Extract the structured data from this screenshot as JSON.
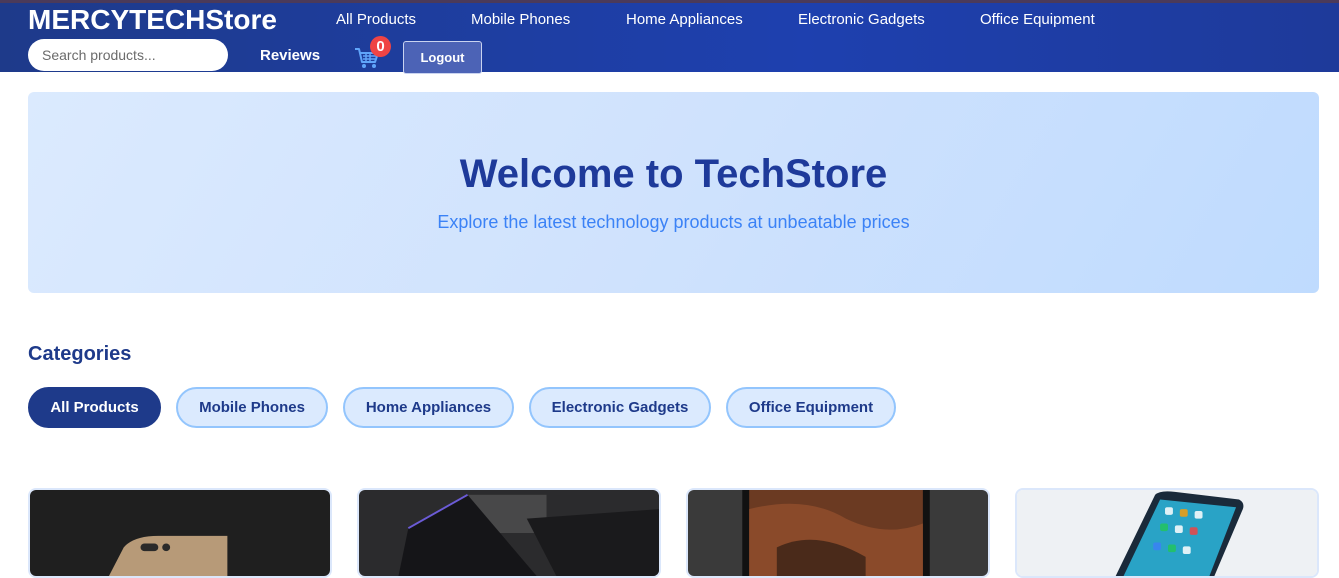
{
  "header": {
    "brand": "MERCYTECHStore",
    "nav": [
      "All Products",
      "Mobile Phones",
      "Home Appliances",
      "Electronic Gadgets",
      "Office Equipment"
    ],
    "search_placeholder": "Search products...",
    "reviews_label": "Reviews",
    "cart_icon": "shopping-cart-icon",
    "cart_count": "0",
    "logout_label": "Logout"
  },
  "hero": {
    "title": "Welcome to TechStore",
    "subtitle": "Explore the latest technology products at unbeatable prices"
  },
  "categories": {
    "title": "Categories",
    "items": [
      "All Products",
      "Mobile Phones",
      "Home Appliances",
      "Electronic Gadgets",
      "Office Equipment"
    ],
    "active": "All Products"
  },
  "products": [
    {
      "image": "phone-gold-dark-background"
    },
    {
      "image": "phone-box-dark-background"
    },
    {
      "image": "phone-wallpaper-dark"
    },
    {
      "image": "phone-apps-light-background"
    }
  ],
  "colors": {
    "header_bg": "#1e40af",
    "accent": "#1e3a8a",
    "badge": "#ef4444",
    "hero_bg": "#dbeafe"
  }
}
